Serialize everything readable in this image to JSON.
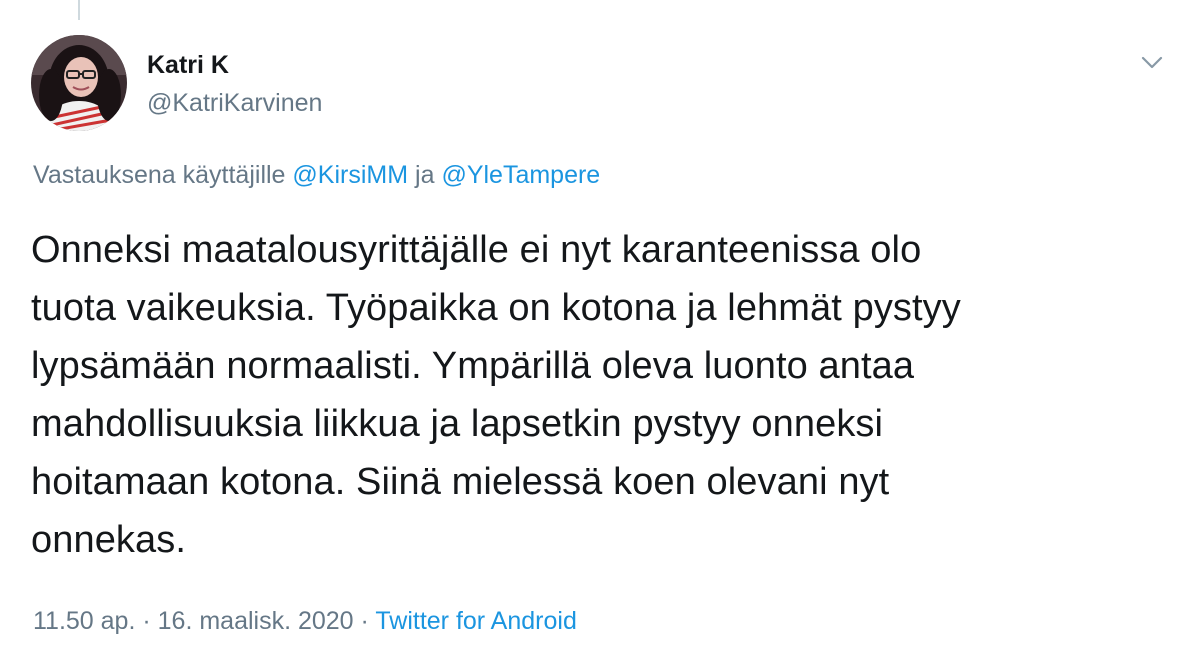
{
  "author": {
    "display_name": "Katri K",
    "handle": "@KatriKarvinen"
  },
  "reply_context": {
    "prefix": "Vastauksena käyttäjille",
    "mention_1": "@KirsiMM",
    "conjunction": "ja",
    "mention_2": "@YleTampere"
  },
  "tweet": {
    "lines": [
      "Onneksi maatalousyrittäjälle ei nyt karanteenissa olo",
      "tuota vaikeuksia. Työpaikka on kotona ja lehmät pystyy",
      "lypsämään normaalisti. Ympärillä oleva luonto antaa",
      "mahdollisuuksia liikkua ja lapsetkin pystyy onneksi",
      "hoitamaan kotona. Siinä mielessä koen olevani nyt",
      "onnekas."
    ]
  },
  "meta": {
    "time": "11.50 ap.",
    "separator": "·",
    "date": "16. maalisk. 2020",
    "source": "Twitter for Android"
  },
  "icons": {
    "caret": "chevron-down-icon",
    "avatar": "profile-photo"
  },
  "colors": {
    "text": "#14171a",
    "secondary": "#657786",
    "link": "#1b95e0"
  }
}
